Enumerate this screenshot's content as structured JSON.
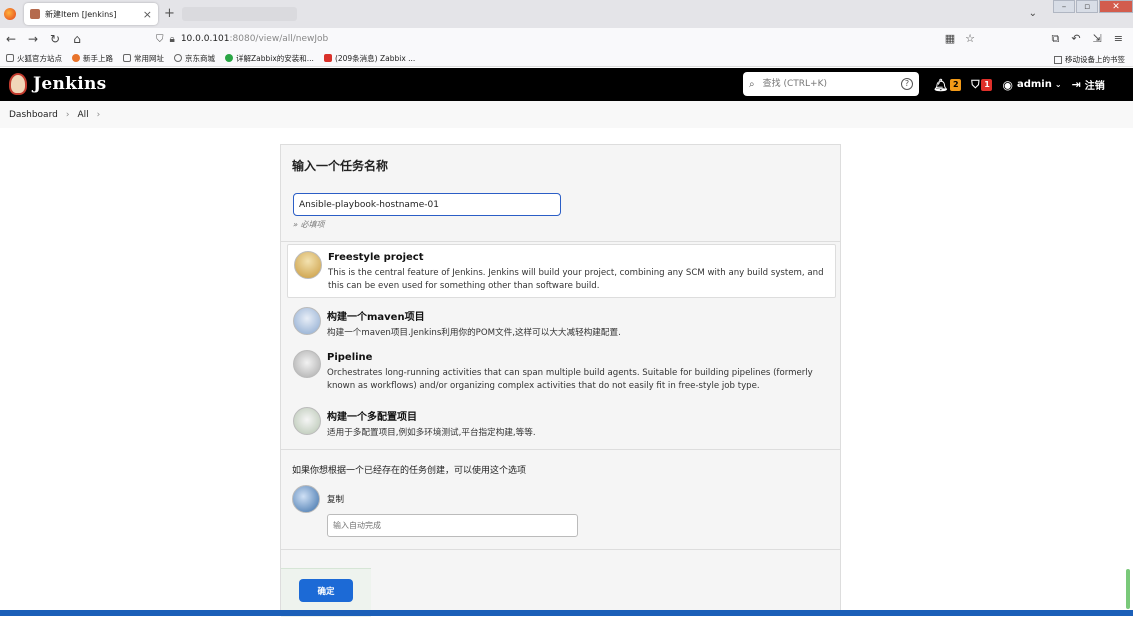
{
  "browser": {
    "tab_title": "新建Item [Jenkins]",
    "url_host": "10.0.0.101",
    "url_path": ":8080/view/all/newJob",
    "bookmarks": [
      {
        "label": "火狐官方站点",
        "color": "#e8732b"
      },
      {
        "label": "新手上路",
        "color": "#e8732b"
      },
      {
        "label": "常用网址",
        "color": "#888888"
      },
      {
        "label": "京东商城",
        "color": "#888888"
      },
      {
        "label": "详解Zabbix的安装和...",
        "color": "#2aa545"
      },
      {
        "label": "(209条消息) Zabbix ...",
        "color": "#d9312a"
      }
    ],
    "mobile_bookmarks": "移动设备上的书签"
  },
  "jenkins": {
    "brand": "Jenkins",
    "search_placeholder": "查找 (CTRL+K)",
    "notifications_count": "2",
    "security_count": "1",
    "user": "admin",
    "logout": "注销"
  },
  "breadcrumb": {
    "dashboard": "Dashboard",
    "all": "All"
  },
  "form": {
    "heading": "输入一个任务名称",
    "job_name": "Ansible-playbook-hostname-01",
    "required_hint": "» 必填项",
    "items": [
      {
        "title": "Freestyle project",
        "desc": "This is the central feature of Jenkins. Jenkins will build your project, combining any SCM with any build system, and this can be even used for something other than software build."
      },
      {
        "title": "构建一个maven项目",
        "desc": "构建一个maven项目.Jenkins利用你的POM文件,这样可以大大减轻构建配置."
      },
      {
        "title": "Pipeline",
        "desc": "Orchestrates long-running activities that can span multiple build agents. Suitable for building pipelines (formerly known as workflows) and/or organizing complex activities that do not easily fit in free-style job type."
      },
      {
        "title": "构建一个多配置项目",
        "desc": "适用于多配置项目,例如多环境测试,平台指定构建,等等."
      }
    ],
    "copy_intro": "如果你想根据一个已经存在的任务创建，可以使用这个选项",
    "copy_label": "复制",
    "copy_placeholder": "输入自动完成",
    "ok_button": "确定"
  },
  "colors": {
    "accent": "#1c6ad6",
    "header_bg": "#000000",
    "badge_orange": "#f29a18",
    "badge_red": "#e0302a"
  }
}
